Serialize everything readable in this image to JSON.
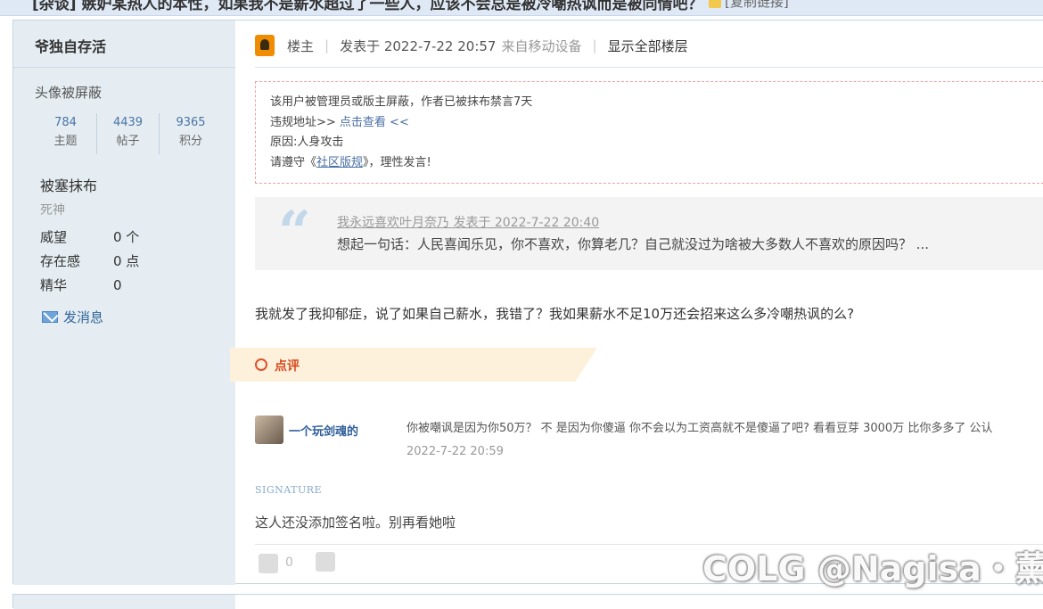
{
  "thread": {
    "title": "[杂谈] 嫉妒某热人的本性，如果我不是薪水超过了一些人，应该不会总是被冷嘲热讽而是被同情吧？",
    "copy_link": "[复制链接]"
  },
  "author": {
    "name": "爷独自存活",
    "avatar_notice": "头像被屏蔽",
    "stats": [
      {
        "value": "784",
        "label": "主题"
      },
      {
        "value": "4439",
        "label": "帖子"
      },
      {
        "value": "9365",
        "label": "积分"
      }
    ],
    "group": "被塞抹布",
    "group_title": "死神",
    "info": [
      {
        "key": "威望",
        "value": "0 个"
      },
      {
        "key": "存在感",
        "value": "0 点"
      },
      {
        "key": "精华",
        "value": "0"
      }
    ],
    "send_message": "发消息"
  },
  "post_header": {
    "role": "楼主",
    "posted": "发表于 2022-7-22 20:57",
    "device": "来自移动设备",
    "show_all": "显示全部楼层"
  },
  "moderation": {
    "line1": "该用户被管理员或版主屏蔽，作者已被抹布禁言7天",
    "line2_prefix": "违规地址>> ",
    "line2_link": "点击查看 <<",
    "line3": "原因:人身攻击",
    "line4_prefix": "请遵守《",
    "line4_link": "社区版规",
    "line4_suffix": "》，理性发言!"
  },
  "quote": {
    "header": "我永远喜欢叶月奈乃 发表于 2022-7-22 20:40",
    "body": "想起一句话：人民喜闻乐见，你不喜欢，你算老几？自己就没过为啥被大多数人不喜欢的原因吗？ ..."
  },
  "content": "我就发了我抑郁症，说了如果自己薪水，我错了？我如果薪水不足10万还会招来这么多冷嘲热讽的么?",
  "rating": {
    "label": "点评"
  },
  "comment": {
    "user": "一个玩剑魂的",
    "text": "你被嘲讽是因为你50万？ 不 是因为你傻逼 你不会以为工资高就不是傻逼了吧? 看看豆芽 3000万 比你多多了 公认",
    "time": "2022-7-22 20:59"
  },
  "signature": {
    "label": "SIGNATURE",
    "text": "这人还没添加签名啦。别再看她啦"
  },
  "footer": {
    "like_count": "0"
  },
  "watermark": "COLG @Nagisa・薰"
}
